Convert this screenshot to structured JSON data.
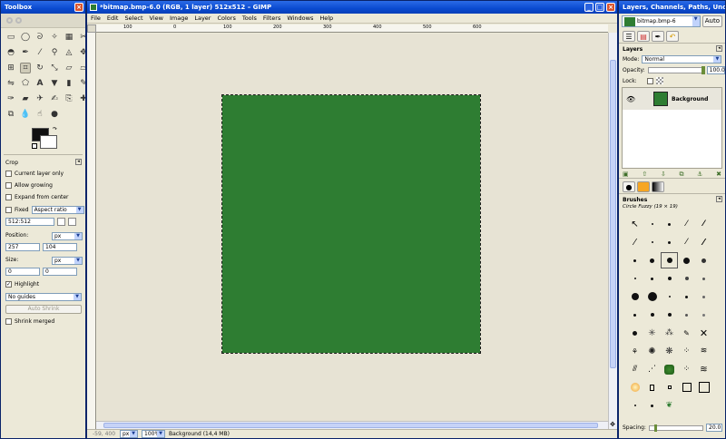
{
  "toolbox": {
    "title": "Toolbox",
    "tool_options_title": "Crop",
    "current_layer_only": "Current layer only",
    "allow_growing": "Allow growing",
    "expand_from_center": "Expand from center",
    "fixed_label": "Fixed",
    "fixed_value": "Aspect ratio",
    "ratio_value": "512:512",
    "position_label": "Position:",
    "position_unit": "px",
    "position_x": "257",
    "position_y": "104",
    "size_label": "Size:",
    "size_unit": "px",
    "size_w": "0",
    "size_h": "0",
    "highlight_label": "Highlight",
    "guides_value": "No guides",
    "auto_shrink": "Auto Shrink",
    "shrink_merged": "Shrink merged"
  },
  "image_window": {
    "title": "*bitmap.bmp-6.0 (RGB, 1 layer) 512x512 – GIMP",
    "menu": [
      "File",
      "Edit",
      "Select",
      "View",
      "Image",
      "Layer",
      "Colors",
      "Tools",
      "Filters",
      "Windows",
      "Help"
    ],
    "ruler_ticks": [
      "100",
      "0",
      "100",
      "200",
      "300",
      "400",
      "500",
      "600"
    ],
    "status_coords": "-59, 400",
    "status_unit": "px",
    "status_zoom": "100%",
    "status_text": "Background (14,4 MB)",
    "image_color": "#2e7d32"
  },
  "layers_window": {
    "title": "Layers, Channels, Paths, Undo - B...",
    "image_select": "bitmap.bmp-6",
    "auto_label": "Auto",
    "layers_title": "Layers",
    "mode_label": "Mode:",
    "mode_value": "Normal",
    "opacity_label": "Opacity:",
    "opacity_value": "100.0",
    "lock_label": "Lock:",
    "layer_name": "Background",
    "brushes_title": "Brushes",
    "brush_name": "Circle Fuzzy (19 × 19)",
    "spacing_label": "Spacing:",
    "spacing_value": "20.0"
  }
}
